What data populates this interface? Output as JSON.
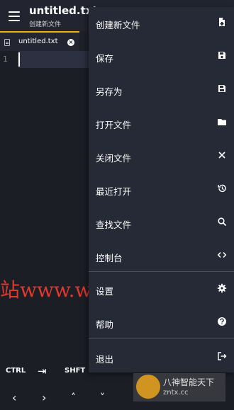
{
  "app_bar": {
    "title": "untitled.txt",
    "subtitle": "创建新文件",
    "menu_icon": "hamburger-icon"
  },
  "tabs": [
    {
      "label": "untitled.txt",
      "icon": "file-icon",
      "close_icon": "close-circle-icon"
    }
  ],
  "editor": {
    "line_numbers": [
      "1"
    ]
  },
  "menu": {
    "items": [
      {
        "label": "创建新文件",
        "icon": "new-file-icon"
      },
      {
        "label": "保存",
        "icon": "save-icon"
      },
      {
        "label": "另存为",
        "icon": "save-as-icon"
      },
      {
        "label": "打开文件",
        "icon": "folder-icon"
      },
      {
        "label": "关闭文件",
        "icon": "close-icon"
      },
      {
        "label": "最近打开",
        "icon": "history-icon"
      },
      {
        "label": "查找文件",
        "icon": "search-icon"
      },
      {
        "label": "控制台",
        "icon": "code-icon"
      },
      {
        "label": "设置",
        "icon": "gear-icon"
      },
      {
        "label": "帮助",
        "icon": "help-icon"
      },
      {
        "label": "退出",
        "icon": "logout-icon"
      }
    ]
  },
  "extra_keys": {
    "ctrl": "CTRL",
    "tab": "⇥",
    "shift": "SHFT",
    "left": "‹",
    "right": "›",
    "up": "˄",
    "down": "˅"
  },
  "watermark": {
    "text": "站www.wlzy.top"
  },
  "logo": {
    "top": "八神智能天下",
    "bottom": "zntx.cc"
  },
  "colors": {
    "accent": "#f0b400",
    "background": "#1c1e26",
    "menu_background": "#262a36",
    "watermark": "#e0382d"
  }
}
